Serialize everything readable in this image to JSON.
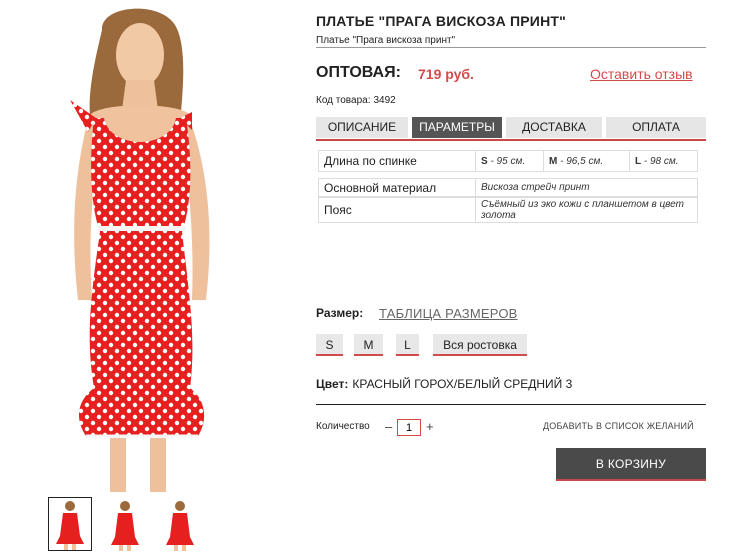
{
  "product": {
    "title": "ПЛАТЬЕ \"ПРАГА ВИСКОЗА ПРИНТ\"",
    "subtitle": "Платье \"Прага вискоза принт\""
  },
  "price": {
    "label": "ОПТОВАЯ:",
    "value": "719 руб."
  },
  "review_link": "Оставить отзыв",
  "sku": {
    "label": "Код товара:",
    "value": "3492"
  },
  "tabs": [
    {
      "label": "ОПИСАНИЕ",
      "active": false
    },
    {
      "label": "ПАРАМЕТРЫ",
      "active": true
    },
    {
      "label": "ДОСТАВКА",
      "active": false
    },
    {
      "label": "ОПЛАТА",
      "active": false
    }
  ],
  "params": {
    "length": {
      "label": "Длина по спинке",
      "s": {
        "size": "S",
        "value": "- 95 см."
      },
      "m": {
        "size": "M",
        "value": "- 96,5 см."
      },
      "l": {
        "size": "L",
        "value": "- 98 см."
      }
    },
    "material": {
      "label": "Основной материал",
      "value": "Вискоза стрейч принт"
    },
    "belt": {
      "label": "Пояс",
      "value": "Съёмный из эко кожи с планшетом в цвет золота"
    }
  },
  "size": {
    "label": "Размер:",
    "table_link": "ТАБЛИЦА РАЗМЕРОВ",
    "options": [
      "S",
      "M",
      "L",
      "Вся ростовка"
    ]
  },
  "color": {
    "label": "Цвет:",
    "value": "КРАСНЫЙ ГОРОХ/БЕЛЫЙ СРЕДНИЙ 3"
  },
  "quantity": {
    "label": "Количество",
    "minus": "–",
    "value": "1",
    "plus": "+"
  },
  "wishlist": "ДОБАВИТЬ В СПИСОК ЖЕЛАНИЙ",
  "cart_button": "В КОРЗИНУ",
  "colors": {
    "accent": "#d24a4a",
    "dark_button": "#4a4a4a",
    "dress": "#e5201f"
  }
}
